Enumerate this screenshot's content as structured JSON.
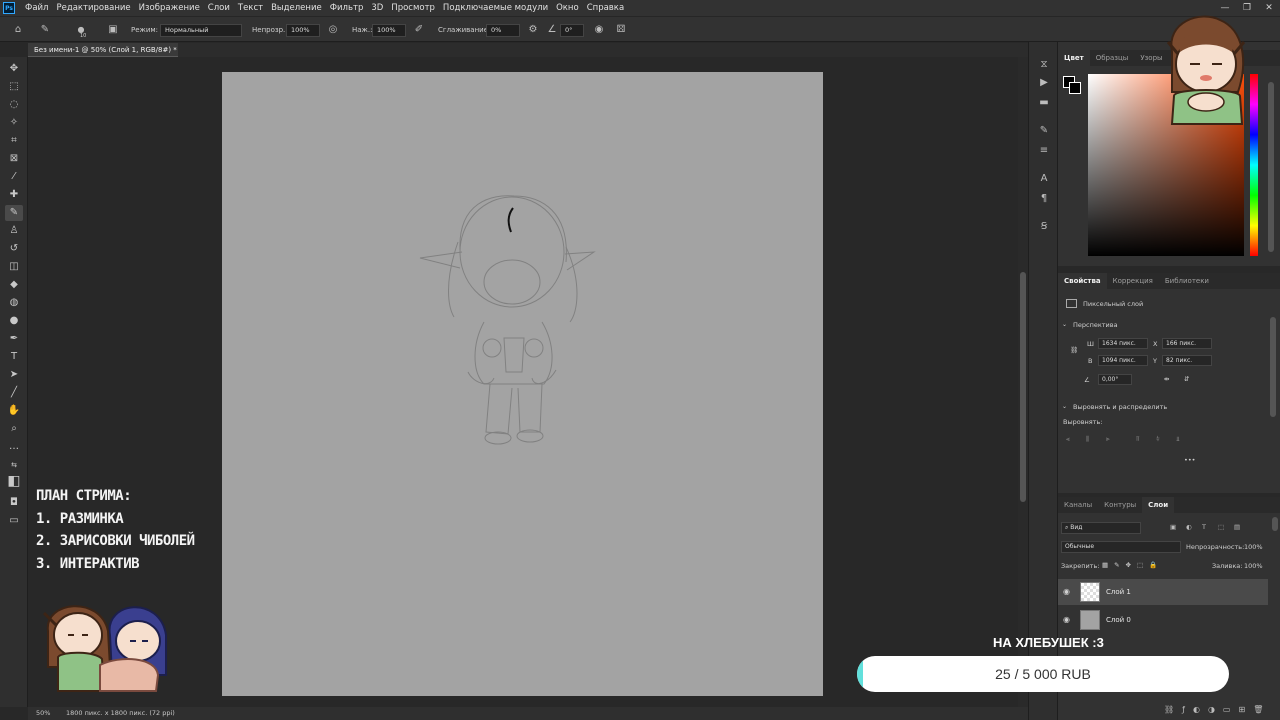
{
  "app": {
    "logo": "Ps"
  },
  "menu": [
    "Файл",
    "Редактирование",
    "Изображение",
    "Слои",
    "Текст",
    "Выделение",
    "Фильтр",
    "3D",
    "Просмотр",
    "Подключаемые модули",
    "Окно",
    "Справка"
  ],
  "window_controls": [
    "—",
    "❐",
    "✕"
  ],
  "options": {
    "mode_label": "Режим:",
    "mode_value": "Нормальный",
    "opacity_label": "Непрозр.:",
    "opacity_value": "100%",
    "pressure_label": "Наж.:",
    "pressure_value": "100%",
    "smoothing_label": "Сглаживание:",
    "smoothing_value": "0%",
    "angle_value": "0°",
    "brush_size": "10"
  },
  "document_tab": "Без имени-1 @ 50% (Слой 1, RGB/8#) *",
  "status": {
    "zoom": "50%",
    "size": "1800 пикс. x 1800 пикс. (72 ppi)"
  },
  "color_panel": {
    "tabs": [
      "Цвет",
      "Образцы",
      "Узоры"
    ],
    "hue_color": "#ff4e0a"
  },
  "properties": {
    "tabs": [
      "Свойства",
      "Коррекция",
      "Библиотеки"
    ],
    "layer_type": "Пиксельный слой",
    "section_transform": "Перспектива",
    "w_label": "Ш",
    "w_value": "1634 пикс.",
    "h_label": "В",
    "h_value": "1094 пикс.",
    "x_label": "X",
    "x_value": "166 пикс.",
    "y_label": "Y",
    "y_value": "82 пикс.",
    "angle_value": "0,00°",
    "section_align": "Выровнять и распределить",
    "align_label": "Выровнять:",
    "more": "•••"
  },
  "layers": {
    "tabs": [
      "Каналы",
      "Контуры",
      "Слои"
    ],
    "filter_label": "Вид",
    "blend_mode": "Обычные",
    "opacity_label": "Непрозрачность:",
    "opacity_value": "100%",
    "lock_label": "Закрепить:",
    "fill_label": "Заливка:",
    "fill_value": "100%",
    "items": [
      {
        "name": "Слой 1",
        "selected": true
      },
      {
        "name": "Слой 0",
        "selected": false
      }
    ]
  },
  "overlay": {
    "plan_title": "ПЛАН СТРИМА:",
    "plan_items": [
      "1. РАЗМИНКА",
      "2. ЗАРИСОВКИ ЧИБОЛЕЙ",
      "3. ИНТЕРАКТИВ"
    ],
    "donation_title": "НА ХЛЕБУШЕК :3",
    "donation_text": "25 / 5 000 RUB",
    "donation_progress": 0.005
  }
}
